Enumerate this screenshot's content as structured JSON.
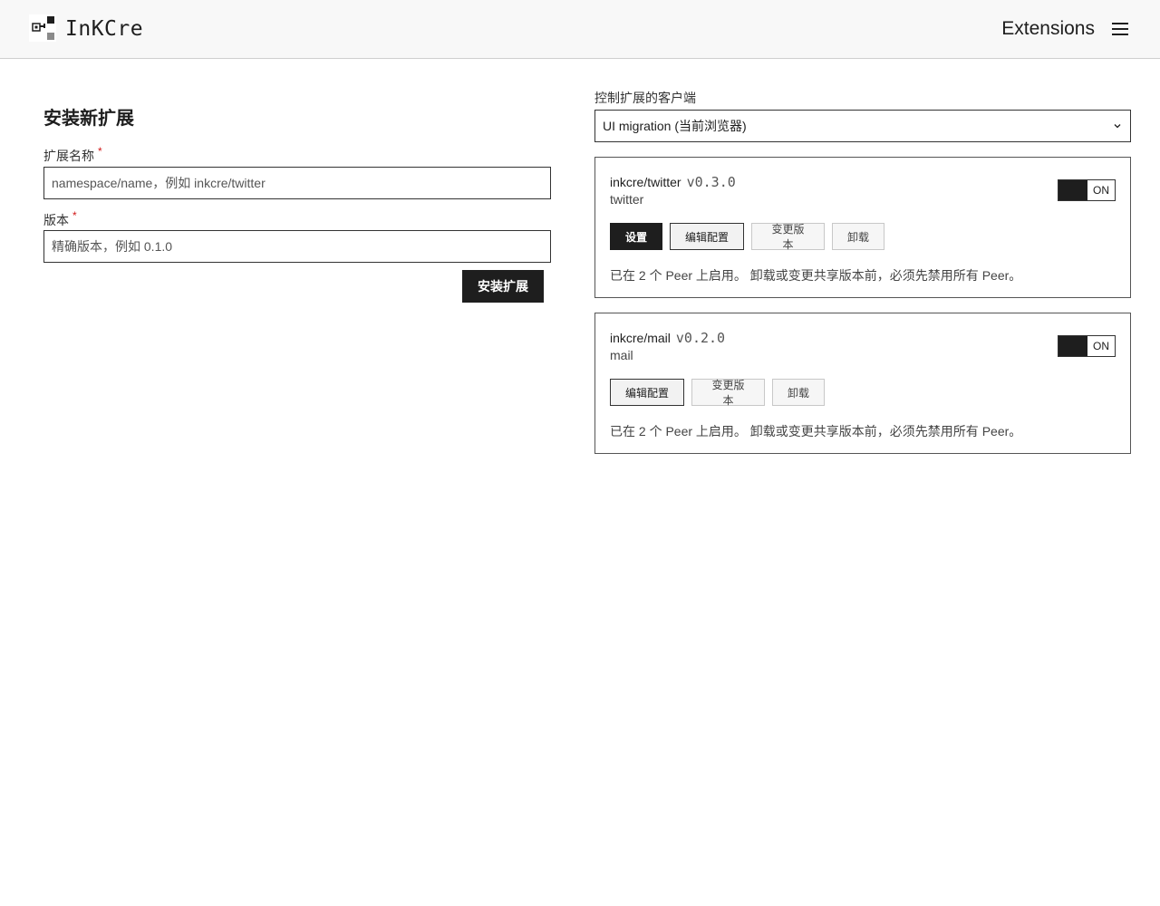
{
  "header": {
    "brand": "InKCre",
    "title": "Extensions",
    "menu_icon": "hamburger-menu-icon",
    "logo_icon": "pixel-logo-icon"
  },
  "install": {
    "title": "安装新扩展",
    "name_label": "扩展名称",
    "required_mark": "*",
    "name_placeholder": "namespace/name，例如 inkcre/twitter",
    "version_label": "版本",
    "version_placeholder": "精确版本，例如 0.1.0",
    "submit_label": "安装扩展"
  },
  "client": {
    "label": "控制扩展的客户端",
    "selected": "UI migration (当前浏览器)",
    "icon": "chevron-down-icon"
  },
  "extensions": [
    {
      "name": "inkcre/twitter",
      "version": "v0.3.0",
      "id": "twitter",
      "toggle_label": "ON",
      "enabled": true,
      "buttons": [
        "设置",
        "编辑配置",
        "变更版本",
        "卸载"
      ],
      "note": "已在 2 个 Peer 上启用。 卸载或变更共享版本前，必须先禁用所有 Peer。"
    },
    {
      "name": "inkcre/mail",
      "version": "v0.2.0",
      "id": "mail",
      "toggle_label": "ON",
      "enabled": true,
      "buttons": [
        "编辑配置",
        "变更版本",
        "卸载"
      ],
      "note": "已在 2 个 Peer 上启用。 卸载或变更共享版本前，必须先禁用所有 Peer。"
    }
  ],
  "colors": {
    "primary": "#1e1e1e",
    "header_bg": "#f8f8f8",
    "required": "#d01818"
  }
}
